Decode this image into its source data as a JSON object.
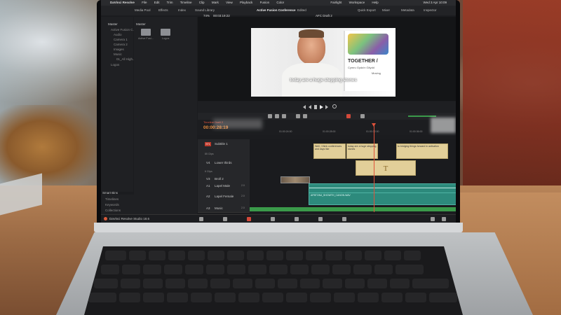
{
  "menubar": {
    "app": "DaVinci Resolve",
    "items": [
      "File",
      "Edit",
      "Trim",
      "Timeline",
      "Clip",
      "Mark",
      "View",
      "Playback",
      "Fusion",
      "Color",
      "Fairlight",
      "Workspace",
      "Help"
    ],
    "clock": "Wed 3 Apr 10:09"
  },
  "toolbar": {
    "media_pool": "Media Pool",
    "effects": "Effects",
    "index": "Index",
    "sound_library": "Sound Library",
    "zoom": "74%",
    "timecode": "00:03:19:22",
    "project_title": "Active Fusion Conference",
    "edited": "Edited",
    "timeline_name": "AFC Draft 2",
    "quick_export": "Quick Export",
    "mixer": "Mixer",
    "metadata": "Metadata",
    "inspector": "Inspector"
  },
  "media_pool": {
    "master_label": "Master",
    "bins": [
      "Active Fusion C...",
      "Audio",
      "Camera 1",
      "Camera 2",
      "Images",
      "Music",
      "01_All High...",
      "Logos"
    ],
    "folder_header": "Master",
    "folders": [
      "Active Fusi...",
      "Logos"
    ],
    "smart_bins": "Smart Bins",
    "smart_items": [
      "Timelines",
      "Keywords",
      "Collections"
    ]
  },
  "viewer": {
    "caption": "today are a huge stepping stones",
    "poster_title": "TOGETHER /",
    "poster_sub": "Cymru Gyda'n Gilydd",
    "poster_word": "Moving"
  },
  "timeline": {
    "timecode": "00:00:28:19",
    "ruler": [
      "01:00:24:00",
      "01:00:28:00",
      "01:00:32:00",
      "01:00:36:00"
    ],
    "tab": "Timeline Draft 2",
    "tracks": [
      {
        "id": "ST1",
        "name": "Subtitle 1",
        "count": "85 Clips"
      },
      {
        "id": "V4",
        "name": "Lower thirds",
        "count": "6 Clips"
      },
      {
        "id": "V3",
        "name": "Broll 2",
        "count": ""
      },
      {
        "id": "A1",
        "name": "Lapel Male",
        "count": "2.0"
      },
      {
        "id": "A2",
        "name": "Lapel Female",
        "count": "2.0"
      },
      {
        "id": "A3",
        "name": "Music",
        "count": "2.0"
      }
    ],
    "subtitles": [
      "Well, I think conferences and days like",
      "today are a huge stepping stones",
      "to bridging things forward in activation"
    ],
    "title_clip": "T",
    "audio_clip": "AFBTON4_SHOWTH_CANON.WAV"
  },
  "bottom_bar": {
    "brand": "DaVinci Resolve Studio 18.6"
  }
}
